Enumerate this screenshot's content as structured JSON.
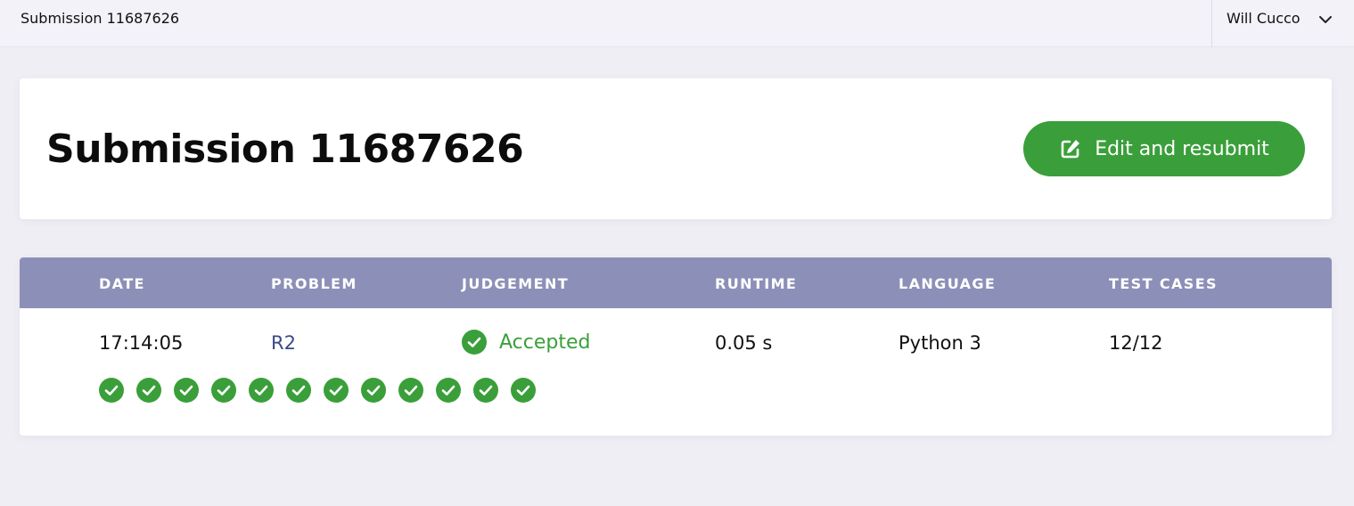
{
  "topbar": {
    "breadcrumb": "Submission 11687626",
    "user_name": "Will Cucco"
  },
  "header": {
    "title": "Submission 11687626",
    "resubmit_label": "Edit and resubmit"
  },
  "table": {
    "columns": [
      "DATE",
      "PROBLEM",
      "JUDGEMENT",
      "RUNTIME",
      "LANGUAGE",
      "TEST CASES"
    ],
    "row": {
      "date": "17:14:05",
      "problem": "R2",
      "judgement": "Accepted",
      "runtime": "0.05 s",
      "language": "Python 3",
      "test_cases": "12/12"
    },
    "test_case_results": [
      "passed",
      "passed",
      "passed",
      "passed",
      "passed",
      "passed",
      "passed",
      "passed",
      "passed",
      "passed",
      "passed",
      "passed"
    ]
  },
  "colors": {
    "accent_green": "#3a9f3a",
    "table_header": "#8c90b8",
    "link": "#3c4a8a"
  },
  "icons": {
    "user_menu": "chevron-down-icon",
    "resubmit": "edit-icon",
    "accepted": "check-circle-icon"
  }
}
